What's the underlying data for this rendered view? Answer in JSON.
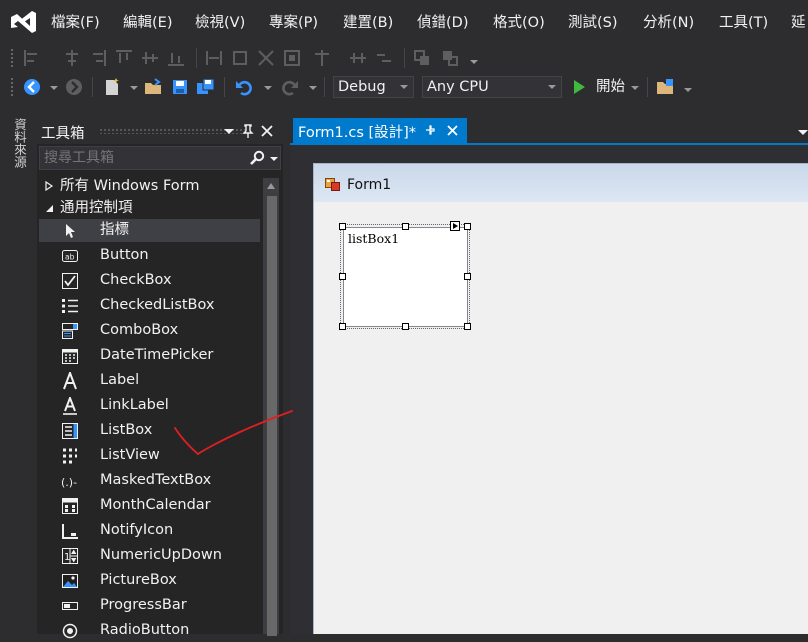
{
  "menu": {
    "items": [
      "檔案(F)",
      "編輯(E)",
      "檢視(V)",
      "專案(P)",
      "建置(B)",
      "偵錯(D)",
      "格式(O)",
      "測試(S)",
      "分析(N)",
      "工具(T)",
      "延"
    ]
  },
  "toolbar": {
    "config": "Debug",
    "platform": "Any CPU",
    "start_label": "開始"
  },
  "side_tab": {
    "label": "資料來源"
  },
  "toolbox": {
    "title": "工具箱",
    "search_placeholder": "搜尋工具箱",
    "categories": [
      "所有 Windows Form",
      "通用控制項"
    ],
    "items": [
      {
        "label": "指標",
        "icon": "pointer-icon"
      },
      {
        "label": "Button",
        "icon": "button-icon"
      },
      {
        "label": "CheckBox",
        "icon": "checkbox-icon"
      },
      {
        "label": "CheckedListBox",
        "icon": "checked-list-icon"
      },
      {
        "label": "ComboBox",
        "icon": "combobox-icon"
      },
      {
        "label": "DateTimePicker",
        "icon": "calendar-icon"
      },
      {
        "label": "Label",
        "icon": "label-icon"
      },
      {
        "label": "LinkLabel",
        "icon": "link-label-icon"
      },
      {
        "label": "ListBox",
        "icon": "listbox-icon"
      },
      {
        "label": "ListView",
        "icon": "listview-icon"
      },
      {
        "label": "MaskedTextBox",
        "icon": "masked-textbox-icon"
      },
      {
        "label": "MonthCalendar",
        "icon": "month-calendar-icon"
      },
      {
        "label": "NotifyIcon",
        "icon": "notify-icon"
      },
      {
        "label": "NumericUpDown",
        "icon": "numeric-updown-icon"
      },
      {
        "label": "PictureBox",
        "icon": "picture-icon"
      },
      {
        "label": "ProgressBar",
        "icon": "progressbar-icon"
      },
      {
        "label": "RadioButton",
        "icon": "radio-icon"
      }
    ]
  },
  "document": {
    "tab_label": "Form1.cs [設計]*",
    "form_title": "Form1",
    "listbox_item": "listBox1"
  },
  "colors": {
    "accent": "#007acc",
    "annotation": "#e02020"
  }
}
